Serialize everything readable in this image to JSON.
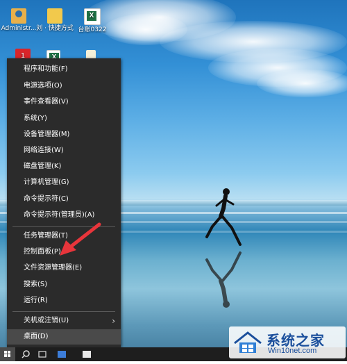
{
  "desktop": {
    "icons": [
      {
        "label": "Administr...",
        "icon": "user-folder-icon"
      },
      {
        "label": "刘 · 快捷方式",
        "icon": "shortcut-icon"
      },
      {
        "label": "台账0322",
        "icon": "excel-icon"
      }
    ]
  },
  "context_menu": {
    "items": [
      {
        "label": "程序和功能(F)"
      },
      {
        "label": "电源选项(O)"
      },
      {
        "label": "事件查看器(V)"
      },
      {
        "label": "系统(Y)"
      },
      {
        "label": "设备管理器(M)"
      },
      {
        "label": "网络连接(W)"
      },
      {
        "label": "磁盘管理(K)"
      },
      {
        "label": "计算机管理(G)"
      },
      {
        "label": "命令提示符(C)"
      },
      {
        "label": "命令提示符(管理员)(A)"
      },
      {
        "label": "任务管理器(T)"
      },
      {
        "label": "控制面板(P)"
      },
      {
        "label": "文件资源管理器(E)"
      },
      {
        "label": "搜索(S)"
      },
      {
        "label": "运行(R)"
      },
      {
        "label": "关机或注销(U)",
        "submenu": true
      },
      {
        "label": "桌面(D)",
        "highlighted": true
      }
    ],
    "submenu_arrow": "›"
  },
  "annotation": {
    "color": "#e8353b"
  },
  "watermark": {
    "title": "系统之家",
    "url": "Win10net.com"
  },
  "colors": {
    "menu_bg": "#2b2b2b",
    "menu_highlight": "#4a4a4a",
    "taskbar": "#1e1e1e"
  }
}
